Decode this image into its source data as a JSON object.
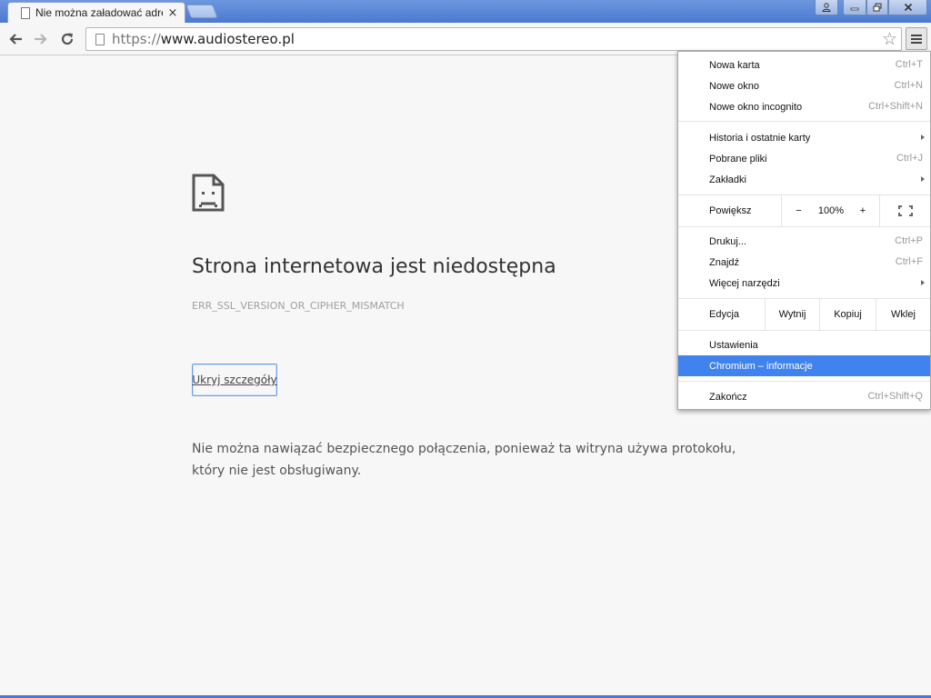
{
  "tab": {
    "title": "Nie można załadować adresu",
    "close_icon": "×"
  },
  "window": {
    "profile_icon": "person-icon",
    "minimize_icon": "minimize-icon",
    "restore_icon": "restore-icon",
    "close_icon": "close-icon"
  },
  "toolbar": {
    "url_scheme": "https://",
    "url_host": "www.audiostereo.pl"
  },
  "page": {
    "heading": "Strona internetowa jest niedostępna",
    "error_code": "ERR_SSL_VERSION_OR_CIPHER_MISMATCH",
    "details_button": "Ukryj szczegóły",
    "details_text": "Nie można nawiązać bezpiecznego połączenia, ponieważ ta witryna używa protokołu, który nie jest obsługiwany."
  },
  "menu": {
    "new_tab": {
      "label": "Nowa karta",
      "shortcut": "Ctrl+T"
    },
    "new_window": {
      "label": "Nowe okno",
      "shortcut": "Ctrl+N"
    },
    "incognito": {
      "label": "Nowe okno incognito",
      "shortcut": "Ctrl+Shift+N"
    },
    "history": {
      "label": "Historia i ostatnie karty"
    },
    "downloads": {
      "label": "Pobrane pliki",
      "shortcut": "Ctrl+J"
    },
    "bookmarks": {
      "label": "Zakładki"
    },
    "zoom": {
      "label": "Powiększ",
      "minus": "−",
      "value": "100%",
      "plus": "+"
    },
    "print": {
      "label": "Drukuj...",
      "shortcut": "Ctrl+P"
    },
    "find": {
      "label": "Znajdź",
      "shortcut": "Ctrl+F"
    },
    "more_tools": {
      "label": "Więcej narzędzi"
    },
    "edit": {
      "label": "Edycja",
      "cut": "Wytnij",
      "copy": "Kopiuj",
      "paste": "Wklej"
    },
    "settings": {
      "label": "Ustawienia"
    },
    "about": {
      "label": "Chromium – informacje"
    },
    "exit": {
      "label": "Zakończ",
      "shortcut": "Ctrl+Shift+Q"
    }
  },
  "colors": {
    "titlebar": "#4a79cf",
    "menu_highlight": "#4183ee",
    "page_background": "#f7f7f7"
  }
}
